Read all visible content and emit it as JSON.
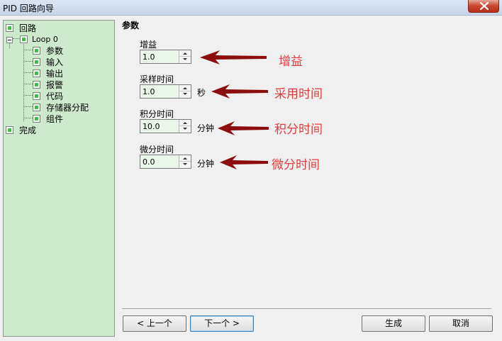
{
  "window": {
    "title": "PID 回路向导",
    "close_icon": "close-icon"
  },
  "tree": {
    "items": [
      {
        "label": "回路"
      },
      {
        "label": "Loop 0"
      },
      {
        "label": "参数"
      },
      {
        "label": "输入"
      },
      {
        "label": "输出"
      },
      {
        "label": "报警"
      },
      {
        "label": "代码"
      },
      {
        "label": "存储器分配"
      },
      {
        "label": "组件"
      },
      {
        "label": "完成"
      }
    ]
  },
  "panel": {
    "title": "参数",
    "fields": [
      {
        "label": "增益",
        "value": "1.0",
        "unit": ""
      },
      {
        "label": "采样时间",
        "value": "1.0",
        "unit": "秒"
      },
      {
        "label": "积分时间",
        "value": "10.0",
        "unit": "分钟"
      },
      {
        "label": "微分时间",
        "value": "0.0",
        "unit": "分钟"
      }
    ]
  },
  "annotations": [
    {
      "text": "增益"
    },
    {
      "text": "采用时间"
    },
    {
      "text": "积分时间"
    },
    {
      "text": "微分时间"
    }
  ],
  "buttons": {
    "prev": "< 上一个",
    "next": "下一个 >",
    "generate": "生成",
    "cancel": "取消"
  },
  "colors": {
    "annotation": "#e23c3c",
    "arrow": "#8b0d0d",
    "tree_bg": "#cfe9cf",
    "field_bg": "#ebf6eb"
  }
}
